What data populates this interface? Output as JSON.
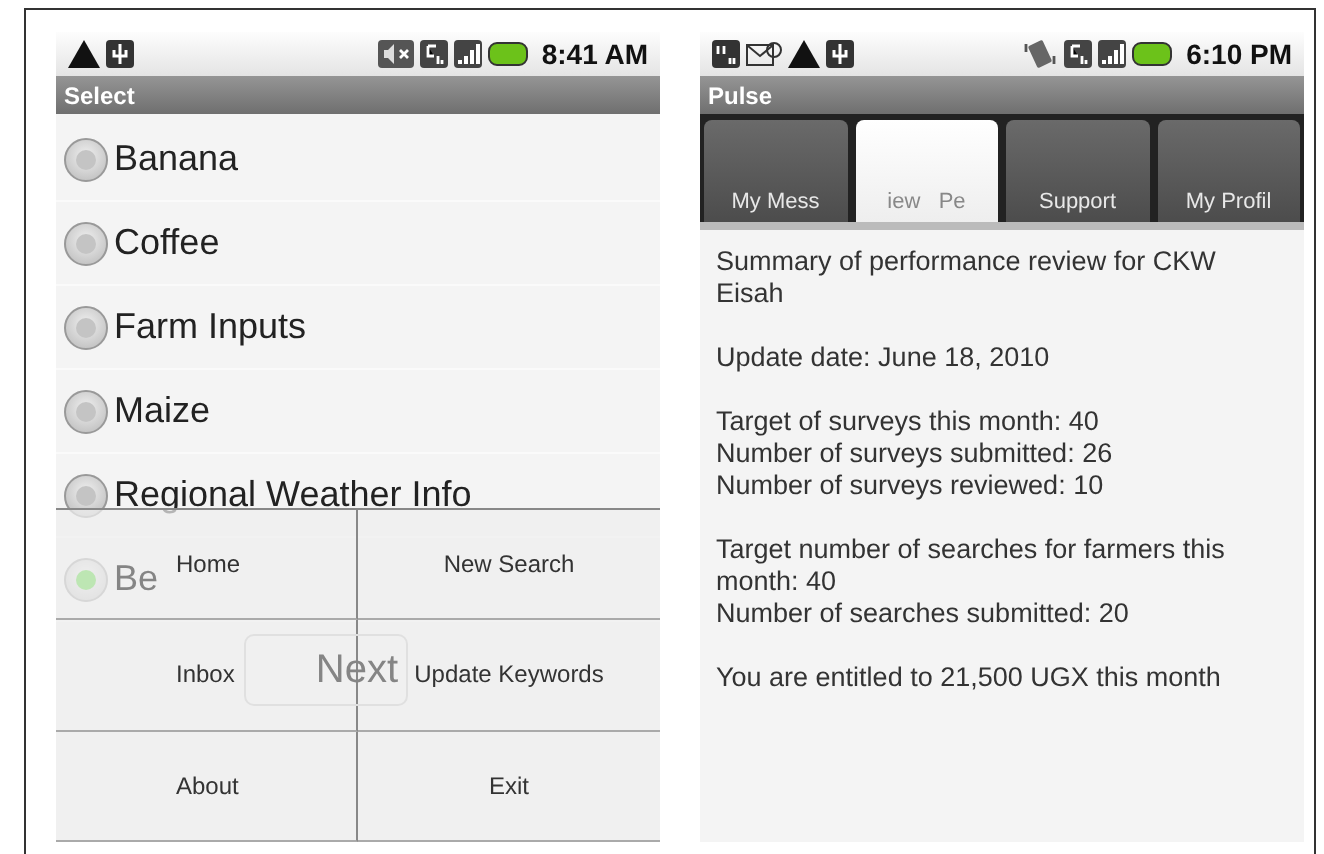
{
  "left_screen": {
    "status_bar": {
      "time": "8:41 AM"
    },
    "title": "Select",
    "options": [
      {
        "label": "Banana",
        "selected": false
      },
      {
        "label": "Coffee",
        "selected": false
      },
      {
        "label": "Farm Inputs",
        "selected": false
      },
      {
        "label": "Maize",
        "selected": false
      },
      {
        "label": "Regional Weather Info",
        "selected": false
      },
      {
        "label": "Be",
        "selected": true
      }
    ],
    "button": "Next",
    "menu": [
      "Home",
      "New Search",
      "Inbox",
      "Update Keywords",
      "About",
      "Exit"
    ]
  },
  "right_screen": {
    "status_bar": {
      "time": "6:10 PM"
    },
    "title": "Pulse",
    "tabs": [
      {
        "label": "My Mess",
        "selected": false
      },
      {
        "label": "iew   Pe",
        "selected": true
      },
      {
        "label": "Support",
        "selected": false
      },
      {
        "label": "My Profil",
        "selected": false
      }
    ],
    "paragraphs": [
      [
        "Summary of performance review for CKW Eisah"
      ],
      [
        "Update date: June 18, 2010"
      ],
      [
        "Target of surveys this month: 40",
        "Number of surveys submitted: 26",
        "Number of surveys reviewed: 10"
      ],
      [
        "Target number of searches for farmers this month: 40",
        "Number of searches submitted: 20"
      ],
      [
        "You are entitled to 21,500 UGX this month"
      ]
    ]
  }
}
